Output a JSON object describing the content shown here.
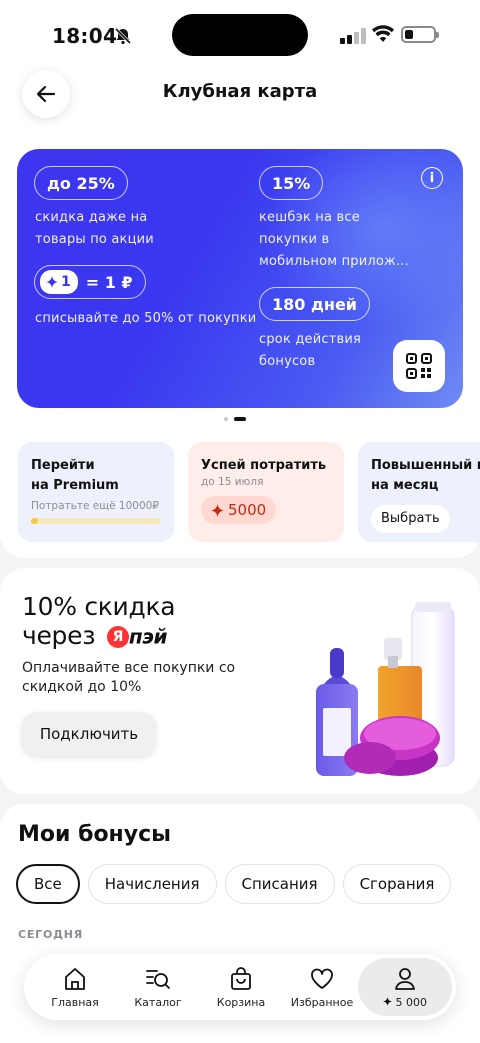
{
  "status_bar": {
    "time": "18:04"
  },
  "header": {
    "title": "Клубная карта"
  },
  "club_card": {
    "discount_pill": "до 25%",
    "discount_text": [
      "скидка даже на",
      "товары по акции"
    ],
    "rate_chip_value": "1",
    "rate_equals": "= 1 ₽",
    "rate_text": "списывайте до 50% от покупки",
    "cashback_pill": "15%",
    "cashback_text": [
      "кешбэк на все",
      "покупки в",
      "мобильном прилож..."
    ],
    "validity_pill": "180 дней",
    "validity_text": [
      "срок действия",
      "бонусов"
    ]
  },
  "tiles": [
    {
      "title": "Перейти на Premium",
      "subtitle": "Потратьте ещё 10000₽",
      "progress": 0.05
    },
    {
      "title": "Успей потратить",
      "subtitle": "до 15 июля",
      "amount": "5000"
    },
    {
      "title": "Повышенный ке на месяц",
      "button": "Выбрать"
    }
  ],
  "promo": {
    "title_line1": "10% скидка",
    "title_line2": "через",
    "pay_logo": "Я",
    "pay_word": "пэй",
    "description": "Оплачивайте все покупки со скидкой до 10%",
    "button": "Подключить"
  },
  "bonuses": {
    "title": "Мои бонусы",
    "filters": [
      "Все",
      "Начисления",
      "Списания",
      "Сгорания"
    ],
    "active_filter": "Все",
    "section_label": "СЕГОДНЯ"
  },
  "tabbar": {
    "items": [
      {
        "label": "Главная",
        "icon": "home-icon"
      },
      {
        "label": "Каталог",
        "icon": "catalog-search-icon"
      },
      {
        "label": "Корзина",
        "icon": "bag-icon"
      },
      {
        "label": "Избранное",
        "icon": "heart-icon"
      },
      {
        "label": "5 000",
        "icon": "profile-icon"
      }
    ]
  },
  "colors": {
    "card_blue": "#3a38f0",
    "bonus_red": "#c42a10",
    "tile_bg_blue": "#eef0fb",
    "tile_bg_pink": "#fdeeea"
  }
}
